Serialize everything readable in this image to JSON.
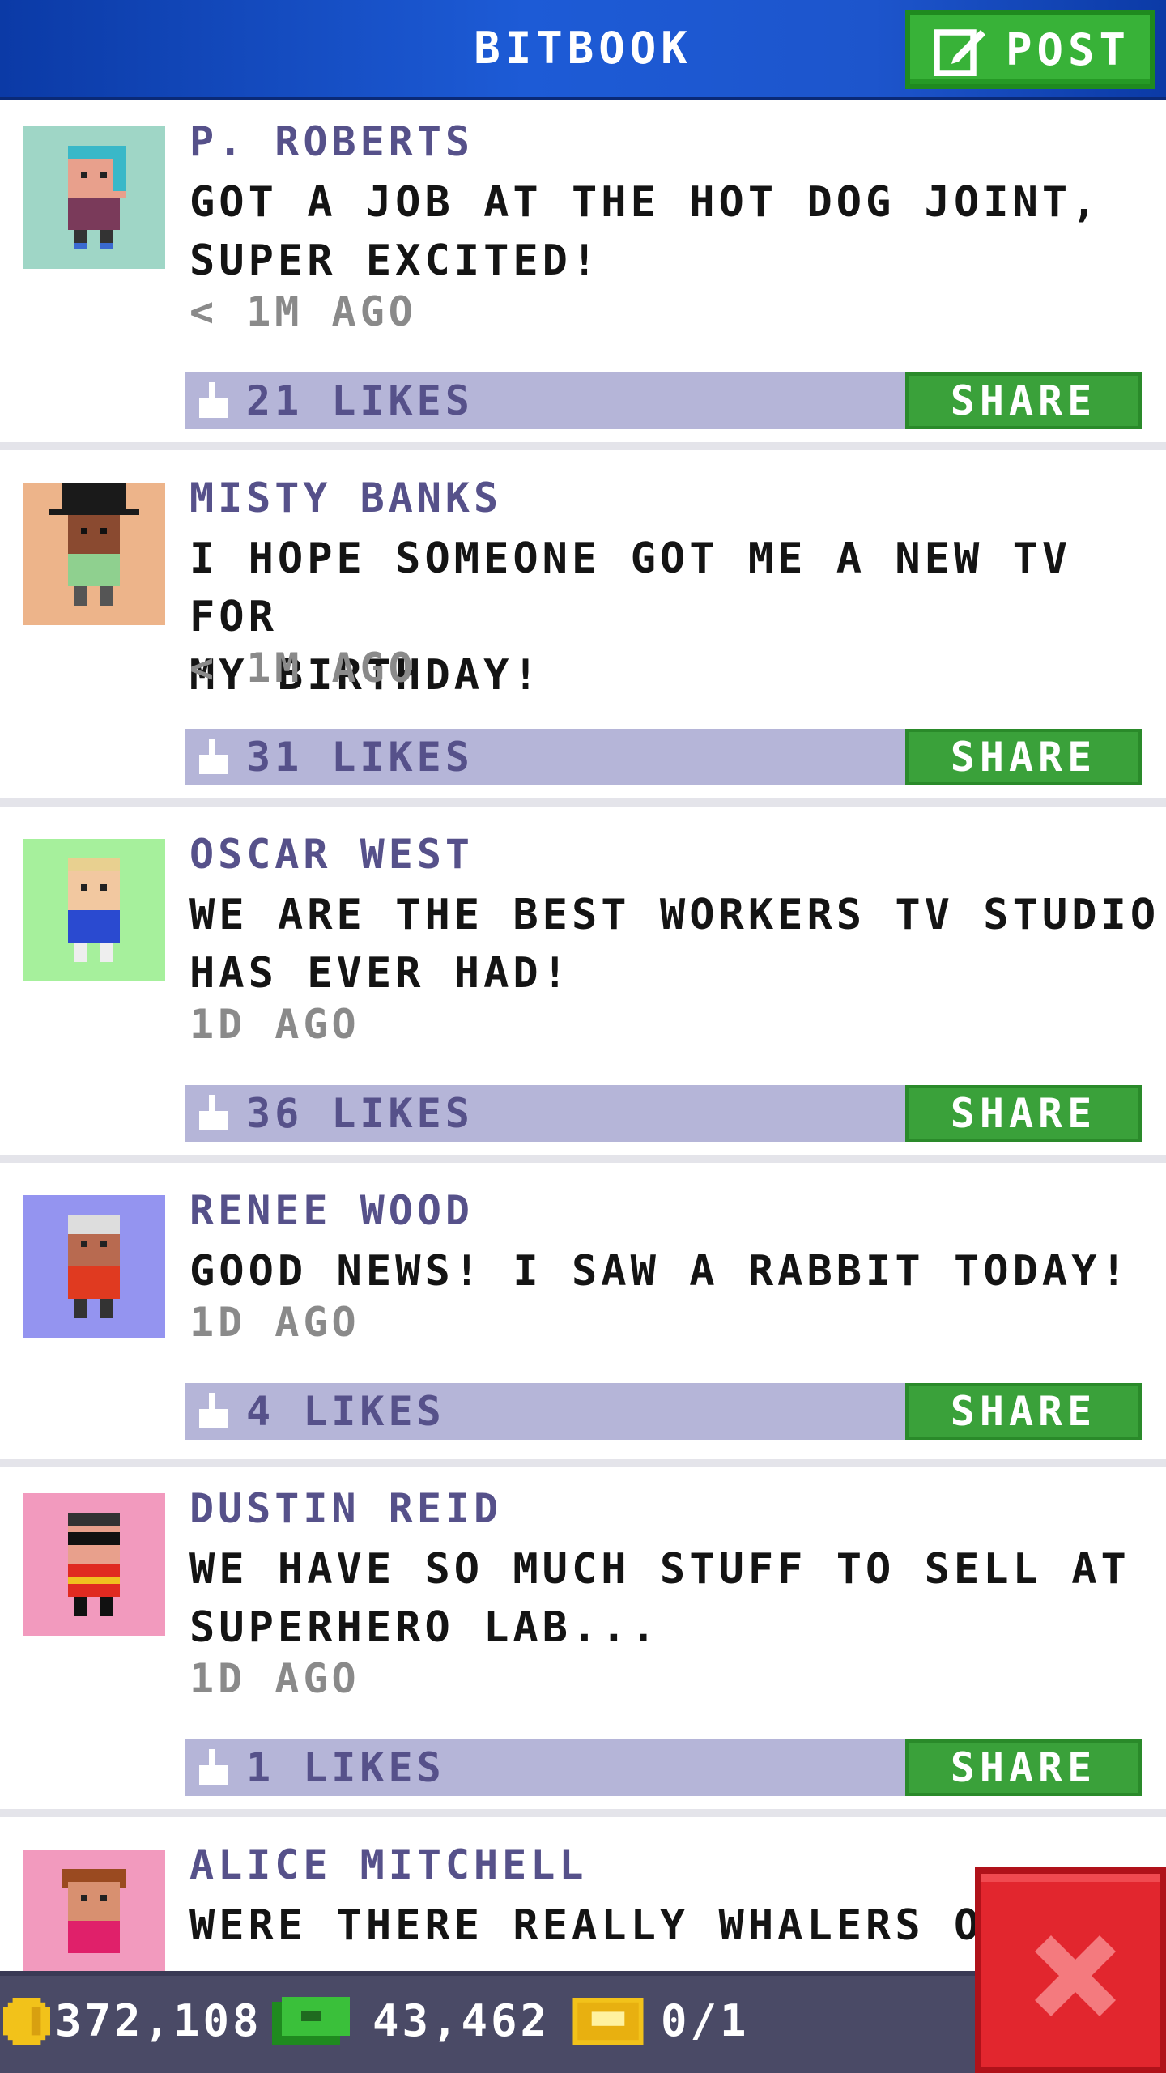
{
  "header": {
    "title": "BITBOOK",
    "post_label": "POST"
  },
  "posts": [
    {
      "author": "P. ROBERTS",
      "message": "GOT A JOB AT THE HOT DOG JOINT,\nSUPER EXCITED!",
      "time": "< 1M AGO",
      "likes": "21 LIKES",
      "share": "SHARE",
      "avatar_bg": "#9fd6c6"
    },
    {
      "author": "MISTY BANKS",
      "message": "I HOPE SOMEONE GOT ME A NEW TV FOR\nMY BIRTHDAY!",
      "time": "< 1M AGO",
      "likes": "31 LIKES",
      "share": "SHARE",
      "avatar_bg": "#edb48a"
    },
    {
      "author": "OSCAR WEST",
      "message": "WE ARE THE BEST WORKERS TV STUDIO\nHAS EVER HAD!",
      "time": "1D AGO",
      "likes": "36 LIKES",
      "share": "SHARE",
      "avatar_bg": "#a6f09c"
    },
    {
      "author": "RENEE WOOD",
      "message": "GOOD NEWS! I SAW A RABBIT TODAY!",
      "time": "1D AGO",
      "likes": "4 LIKES",
      "share": "SHARE",
      "avatar_bg": "#9494f0"
    },
    {
      "author": "DUSTIN REID",
      "message": "WE HAVE SO MUCH STUFF TO SELL AT\nSUPERHERO LAB...",
      "time": "1D AGO",
      "likes": "1 LIKES",
      "share": "SHARE",
      "avatar_bg": "#f29abe"
    },
    {
      "author": "ALICE MITCHELL",
      "message": "WERE THERE REALLY WHALERS OI",
      "avatar_bg": "#f29abe"
    }
  ],
  "footer": {
    "coins": "372,108",
    "cash": "43,462",
    "tickets": "0/1"
  },
  "colors": {
    "header_blue": "#1d55cc",
    "share_green": "#3aa13a",
    "likes_bar": "#b5b5d8",
    "close_red": "#e2262e"
  },
  "icons": {
    "post": "edit-icon",
    "like": "thumbs-up-icon",
    "coin": "coin-icon",
    "cash": "cash-icon",
    "ticket": "ticket-icon",
    "close": "close-icon"
  }
}
